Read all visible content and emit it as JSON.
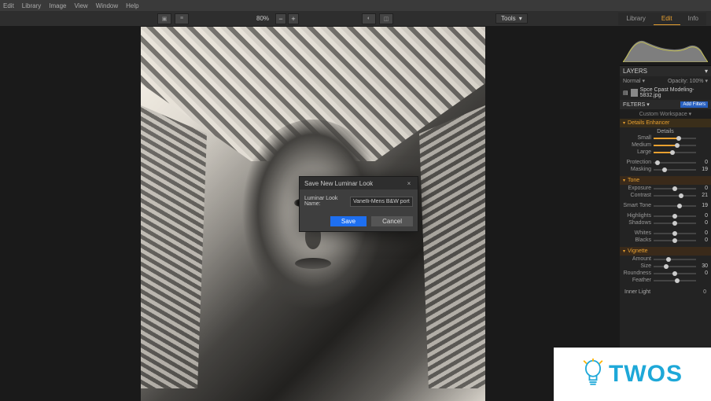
{
  "menubar": {
    "items": [
      "Edit",
      "Library",
      "Image",
      "View",
      "Window",
      "Help"
    ]
  },
  "toolbar": {
    "zoom_value": "80%",
    "zoom_minus": "−",
    "zoom_plus": "+",
    "tools_label": "Tools",
    "tabs": {
      "library": "Library",
      "edit": "Edit",
      "info": "Info"
    }
  },
  "panel": {
    "layers_header": "LAYERS",
    "blend_mode": "Normal",
    "opacity_label": "Opacity:",
    "opacity_value": "100%",
    "layer_name": "Spce Cpast Modeling-5832.jpg",
    "filters_header": "FILTERS",
    "add_filters": "Add Filters",
    "workspace": "Custom Workspace",
    "details_enhancer": {
      "title": "Details Enhancer",
      "details_label": "Details",
      "sliders": [
        {
          "label": "Small",
          "value": "",
          "pos": 60
        },
        {
          "label": "Medium",
          "value": "",
          "pos": 55
        },
        {
          "label": "Large",
          "value": "",
          "pos": 45
        }
      ],
      "protection": {
        "label": "Protection",
        "value": "0",
        "pos": 10
      },
      "masking": {
        "label": "Masking",
        "value": "19",
        "pos": 25
      }
    },
    "tone": {
      "title": "Tone",
      "exposure": {
        "label": "Exposure",
        "value": "0",
        "pos": 50
      },
      "contrast": {
        "label": "Contrast",
        "value": "21",
        "pos": 65
      },
      "smart_tone": {
        "label": "Smart Tone",
        "value": "19",
        "pos": 62
      },
      "highlights": {
        "label": "Highlights",
        "value": "0",
        "pos": 50
      },
      "shadows": {
        "label": "Shadows",
        "value": "0",
        "pos": 50
      },
      "whites": {
        "label": "Whites",
        "value": "0",
        "pos": 50
      },
      "blacks": {
        "label": "Blacks",
        "value": "0",
        "pos": 50
      }
    },
    "vignette": {
      "title": "Vignette",
      "amount": {
        "label": "Amount",
        "value": "",
        "pos": 35
      },
      "size": {
        "label": "Size",
        "value": "30",
        "pos": 30
      },
      "roundness": {
        "label": "Roundness",
        "value": "0",
        "pos": 50
      },
      "feather": {
        "label": "Feather",
        "value": "",
        "pos": 55
      },
      "inner_light": {
        "label": "Inner Light",
        "value": "0"
      }
    }
  },
  "dialog": {
    "title": "Save New Luminar Look",
    "name_label": "Luminar Look Name:",
    "name_value": "Vanelli-Mens B&W portrait",
    "save": "Save",
    "cancel": "Cancel"
  },
  "watermark": {
    "text": "TWOS"
  }
}
